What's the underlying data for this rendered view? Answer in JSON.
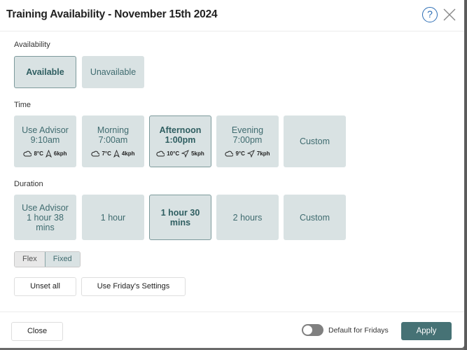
{
  "dialog": {
    "title": "Training Availability - November 15th 2024",
    "help_icon": "question-circle-icon",
    "close_icon": "close-x-icon"
  },
  "availability": {
    "label": "Availability",
    "options": [
      {
        "label": "Available",
        "selected": true
      },
      {
        "label": "Unavailable",
        "selected": false
      }
    ]
  },
  "time": {
    "label": "Time",
    "options": [
      {
        "line1": "Use Advisor",
        "line2": "9:10am",
        "temp": "8°C",
        "wind": "6kph",
        "weather_icon": "cloud-icon",
        "wind_icon": "wind-direction-north-icon",
        "selected": false
      },
      {
        "line1": "Morning",
        "line2": "7:00am",
        "temp": "7°C",
        "wind": "4kph",
        "weather_icon": "cloud-icon",
        "wind_icon": "wind-direction-north-icon",
        "selected": false
      },
      {
        "line1": "Afternoon",
        "line2": "1:00pm",
        "temp": "10°C",
        "wind": "5kph",
        "weather_icon": "cloud-icon",
        "wind_icon": "wind-direction-northeast-icon",
        "selected": true
      },
      {
        "line1": "Evening",
        "line2": "7:00pm",
        "temp": "9°C",
        "wind": "7kph",
        "weather_icon": "cloud-icon",
        "wind_icon": "wind-direction-northeast-icon",
        "selected": false
      },
      {
        "line1": "Custom",
        "selected": false
      }
    ]
  },
  "duration": {
    "label": "Duration",
    "options": [
      {
        "lines": [
          "Use Advisor",
          "1 hour 38",
          "mins"
        ],
        "selected": false
      },
      {
        "lines": [
          "1 hour"
        ],
        "selected": false
      },
      {
        "lines": [
          "1 hour 30",
          "mins"
        ],
        "selected": true
      },
      {
        "lines": [
          "2 hours"
        ],
        "selected": false
      },
      {
        "lines": [
          "Custom"
        ],
        "selected": false
      }
    ]
  },
  "mode": {
    "options": [
      "Flex",
      "Fixed"
    ],
    "selected": "Fixed"
  },
  "actions": {
    "unset_all": "Unset all",
    "use_friday": "Use Friday's Settings"
  },
  "footer": {
    "close": "Close",
    "default_toggle_label": "Default for Fridays",
    "default_toggle_on": false,
    "apply": "Apply"
  },
  "colors": {
    "accent": "#467275",
    "tile_bg": "#d9e2e3",
    "tile_text": "#3f6b6f",
    "help_blue": "#2a6cb4"
  }
}
